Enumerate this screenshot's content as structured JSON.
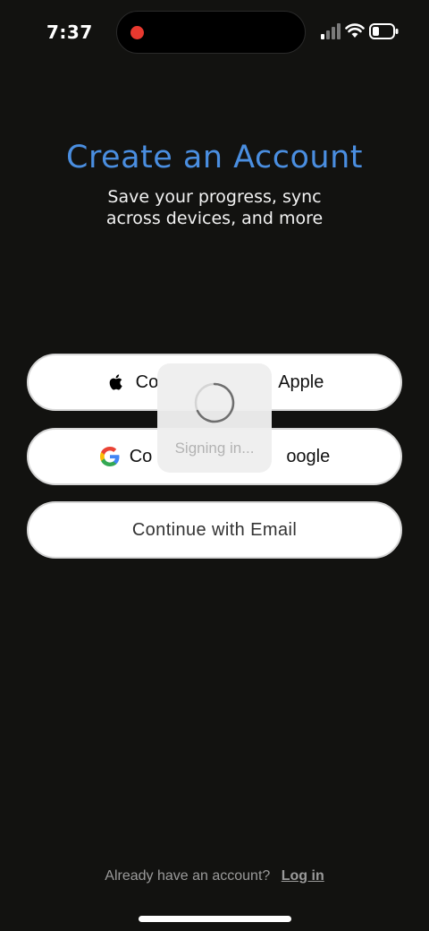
{
  "status_bar": {
    "time": "7:37",
    "recording_indicator_color": "#e8392f",
    "signal_icon": "cellular-signal-icon",
    "wifi_icon": "wifi-icon",
    "battery_icon": "battery-icon"
  },
  "header": {
    "title": "Create an Account",
    "subtitle_line1": "Save your progress, sync",
    "subtitle_line2": "across devices, and more"
  },
  "buttons": {
    "apple_label": "Continue with Apple",
    "apple_visible_left": "Co",
    "apple_visible_right": "Apple",
    "google_label": "Continue with Google",
    "google_visible_left": "Co",
    "google_visible_right": "oogle",
    "email_label": "Continue with Email"
  },
  "overlay": {
    "label": "Signing in..."
  },
  "footer": {
    "prompt": "Already have an account?",
    "login_link": "Log in"
  },
  "colors": {
    "background": "#121210",
    "accent": "#4a8ee0",
    "button_bg": "#ffffff"
  }
}
